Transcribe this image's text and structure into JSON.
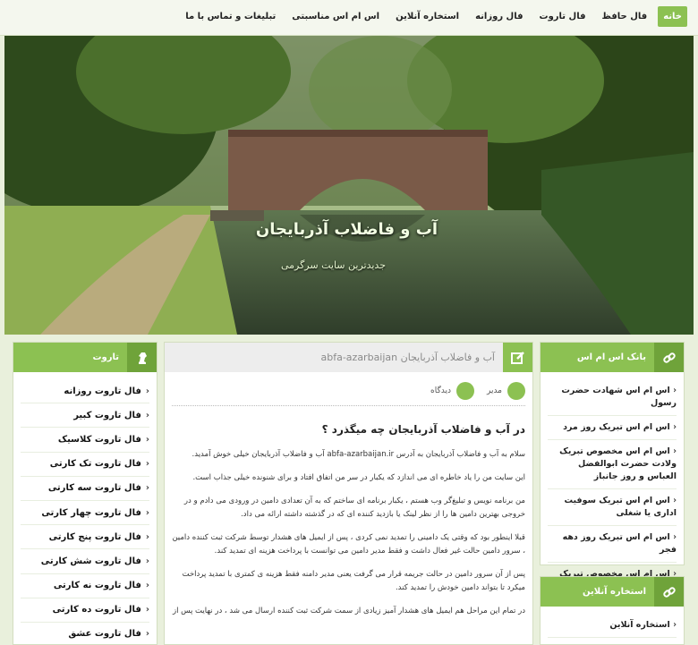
{
  "nav": {
    "items": [
      "خانه",
      "فال حافظ",
      "فال تاروت",
      "فال روزانه",
      "استخاره آنلاین",
      "اس ام اس مناسبتی",
      "تبلیغات و تماس با ما"
    ]
  },
  "hero": {
    "title": "آب و فاضلاب آذربایجان",
    "tagline": "جدیدترین سایت سرگرمی"
  },
  "tarot_widget": {
    "title": "تاروت",
    "items": [
      "فال تاروت روزانه",
      "فال تاروت کبیر",
      "فال تاروت کلاسیک",
      "فال تاروت تک کارتی",
      "فال تاروت سه کارتی",
      "فال تاروت چهار کارتی",
      "فال تاروت پنج کارتی",
      "فال تاروت شش کارتی",
      "فال تاروت نه کارتی",
      "فال تاروت ده کارتی",
      "فال تاروت عشق"
    ]
  },
  "article": {
    "header": "آب و فاضلاب آذربایجان abfa-azarbaijan",
    "author": "مدیر",
    "comments": "دیدگاه",
    "title": "در آب و فاضلاب آذربایجان چه میگذرد ؟",
    "paragraphs": [
      "سلام به آب و فاضلاب آذربایجان به آدرس abfa-azarbaijan.ir آب و فاضلاب آذربایجان خیلی خوش آمدید.",
      "این سایت من را یاد خاطره ای می اندازد که یکبار در سر من اتفاق افتاد و برای شنونده خیلی جذاب است.",
      "من برنامه نویس و تبلیغ‌گر وب هستم ، یکبار برنامه ای ساختم که به آن تعدادی دامین در ورودی می دادم و در خروجی بهترین دامین ها را از نظر لینک یا بازدید کننده ای که در گذشته داشته ارائه می داد.",
      "قبلا اینطور بود که وقتی یک دامینی را تمدید نمی کردی ، پس از ایمیل های هشدار توسط شرکت ثبت کننده دامین ، سرور دامین حالت غیر فعال داشت و فقط مدیر دامین می توانست با پرداخت هزینه ای تمدید کند.",
      "پس از آن سرور دامین در حالت جریمه قرار می گرفت یعنی مدیر دامنه فقط هزینه ی کمتری با تمدید پرداخت میکرد تا بتواند دامین خودش را تمدید کند.",
      "در تمام این مراحل هم ایمیل های هشدار آمیز زیادی از سمت شرکت ثبت کننده ارسال می شد ، در نهایت پس از"
    ]
  },
  "sms_widget": {
    "title": "بانک اس ام اس",
    "items": [
      "اس ام اس شهادت حضرت رسول",
      "اس ام اس تبریک روز مرد",
      "اس ام اس مخصوص تبریک ولادت حضرت ابوالفضل العباس و روز جانباز",
      "اس ام اس تبریک سوفیت اداری یا شغلی",
      "اس ام اس تبریک روز دهه فجر",
      "اس ام اس مخصوص تبریک ولادت حضرت زینب و روز پرستار"
    ]
  },
  "istikhare_widget": {
    "title": "استخاره آنلاین",
    "items": [
      "استخاره آنلاین"
    ]
  },
  "colors": {
    "accent": "#8cc152",
    "accent_dark": "#6fa33a",
    "background": "#e9f0dc"
  }
}
